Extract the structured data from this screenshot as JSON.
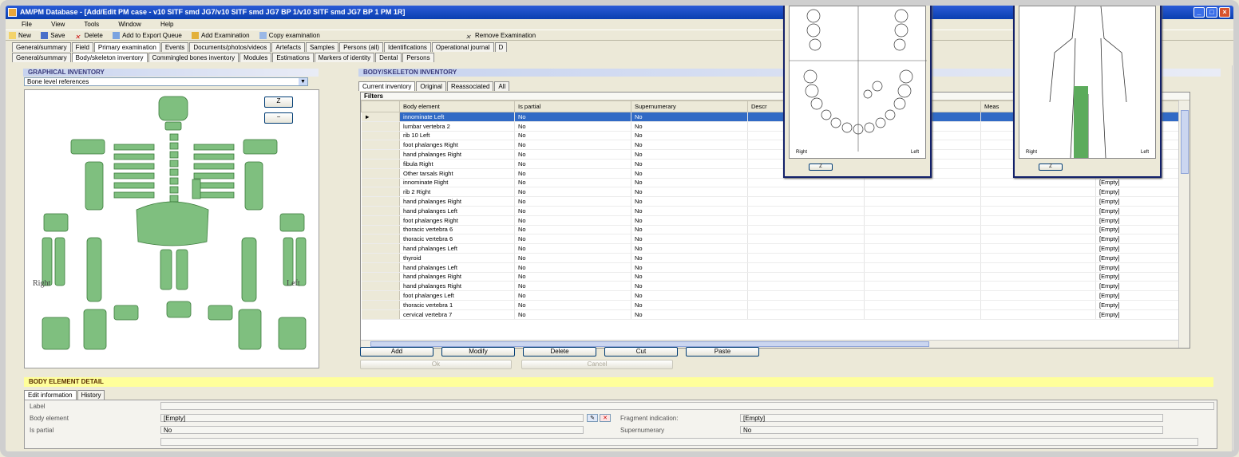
{
  "window": {
    "title": "AM/PM Database - [Add/Edit PM case - v10 SITF smd JG7/v10 SITF smd JG7 BP 1/v10 SITF smd JG7 BP 1 PM 1R]"
  },
  "menu": [
    "File",
    "View",
    "Tools",
    "Window",
    "Help"
  ],
  "toolbar": [
    "New",
    "Save",
    "Delete",
    "Add to Export Queue",
    "Add Examination",
    "Copy examination",
    "Remove Examination"
  ],
  "tabs_row1": [
    "General/summary",
    "Field",
    "Primary examination",
    "Events",
    "Documents/photos/videos",
    "Artefacts",
    "Samples",
    "Persons (all)",
    "Identifications",
    "Operational journal",
    "D"
  ],
  "tabs_row2": [
    "General/summary",
    "Body/skeleton inventory",
    "Commingled bones inventory",
    "Modules",
    "Estimations",
    "Markers of identity",
    "Dental",
    "Persons"
  ],
  "graphical": {
    "header": "GRAPHICAL INVENTORY",
    "select_value": "Bone level references",
    "right_label": "Right",
    "left_label": "Left",
    "zoom_in": "Z",
    "zoom_out": "−"
  },
  "inventory": {
    "header": "BODY/SKELETON INVENTORY",
    "tabs": [
      "Current inventory",
      "Original",
      "Reassociated",
      "All"
    ],
    "filters_label": "Filters",
    "columns": [
      "Body element",
      "Is partial",
      "Supernumerary",
      "Descr",
      "",
      "Meas",
      ""
    ],
    "rows": [
      [
        "innominate Left",
        "No",
        "No",
        ""
      ],
      [
        "lumbar vertebra 2",
        "No",
        "No",
        ""
      ],
      [
        "rib 10 Left",
        "No",
        "No",
        ""
      ],
      [
        "foot phalanges Right",
        "No",
        "No",
        ""
      ],
      [
        "hand phalanges Right",
        "No",
        "No",
        ""
      ],
      [
        "fibula Right",
        "No",
        "No",
        ""
      ],
      [
        "Other tarsals Right",
        "No",
        "No",
        "[Empty]"
      ],
      [
        "innominate Right",
        "No",
        "No",
        "[Empty]"
      ],
      [
        "rib 2 Right",
        "No",
        "No",
        "[Empty]"
      ],
      [
        "hand phalanges Right",
        "No",
        "No",
        "[Empty]"
      ],
      [
        "hand phalanges Left",
        "No",
        "No",
        "[Empty]"
      ],
      [
        "foot phalanges Right",
        "No",
        "No",
        "[Empty]"
      ],
      [
        "thoracic vertebra 6",
        "No",
        "No",
        "[Empty]"
      ],
      [
        "thoracic vertebra 6",
        "No",
        "No",
        "[Empty]"
      ],
      [
        "hand phalanges Left",
        "No",
        "No",
        "[Empty]"
      ],
      [
        "thyroid",
        "No",
        "No",
        "[Empty]"
      ],
      [
        "hand phalanges Left",
        "No",
        "No",
        "[Empty]"
      ],
      [
        "hand phalanges Right",
        "No",
        "No",
        "[Empty]"
      ],
      [
        "hand phalanges Right",
        "No",
        "No",
        "[Empty]"
      ],
      [
        "foot phalanges Left",
        "No",
        "No",
        "[Empty]"
      ],
      [
        "thoracic vertebra 1",
        "No",
        "No",
        "[Empty]"
      ],
      [
        "cervical vertebra 7",
        "No",
        "No",
        "[Empty]"
      ]
    ],
    "buttons": [
      "Add",
      "Modify",
      "Delete",
      "Cut",
      "Paste"
    ],
    "ok": "Ok",
    "cancel": "Cancel"
  },
  "dental_popup": {
    "right": "Right",
    "left": "Left",
    "button": "Z"
  },
  "body_popup": {
    "right": "Right",
    "left": "Left",
    "button": "Z"
  },
  "detail": {
    "header": "BODY ELEMENT DETAIL",
    "tabs": [
      "Edit information",
      "History"
    ],
    "label_lbl": "Label",
    "body_element_lbl": "Body element",
    "body_element_val": "[Empty]",
    "fragment_lbl": "Fragment indication:",
    "fragment_val": "[Empty]",
    "is_partial_lbl": "Is partial",
    "is_partial_val": "No",
    "supernumerary_lbl": "Supernumerary",
    "supernumerary_val": "No"
  },
  "colors": {
    "selection": "#316ac5",
    "bone": "#7fbf7f",
    "detail_header": "#ffff9a"
  }
}
